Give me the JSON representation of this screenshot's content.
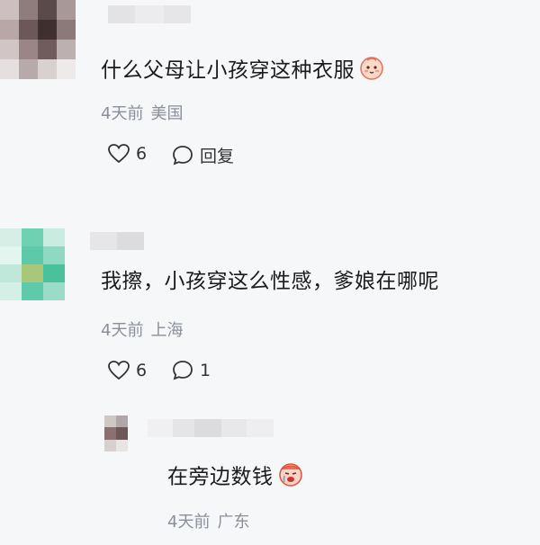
{
  "comments": [
    {
      "text": "什么父母让小孩穿这种衣服",
      "time": "4天前",
      "location": "美国",
      "likes": "6",
      "reply_label": "回复",
      "emoji": "baby-face-emoji"
    },
    {
      "text": "我擦，小孩穿这么性感，爹娘在哪呢",
      "time": "4天前",
      "location": "上海",
      "likes": "6",
      "replies": "1"
    }
  ],
  "reply": {
    "text": "在旁边数钱",
    "time": "4天前",
    "location": "广东",
    "emoji": "crying-face-emoji"
  },
  "colors": {
    "background": "#f6f7f9",
    "meta": "#8a8f99",
    "text": "#1b1b1b"
  }
}
